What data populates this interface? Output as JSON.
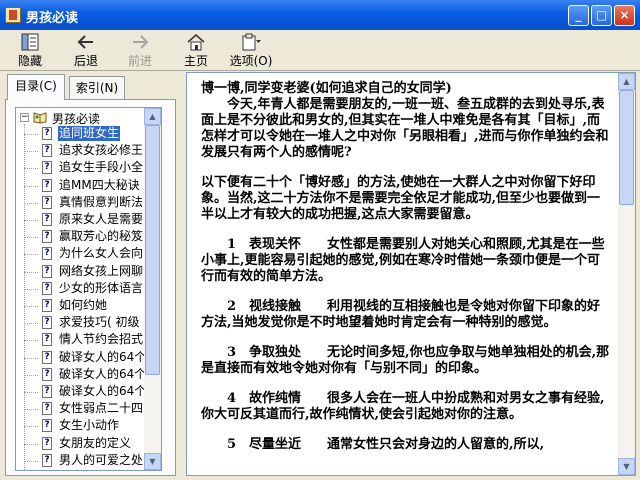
{
  "window": {
    "title": "男孩必读",
    "minimize_glyph": "_",
    "maximize_glyph": "□",
    "close_glyph": "×"
  },
  "toolbar": {
    "hide_label": "隐藏",
    "back_label": "后退",
    "forward_label": "前进",
    "home_label": "主页",
    "options_label": "选项(O)"
  },
  "tabs": {
    "contents_label": "目录(C)",
    "index_label": "索引(N)"
  },
  "tree": {
    "root_label": "男孩必读",
    "items": [
      "追同班女生",
      "追求女孩必修王",
      "追女生手段小全",
      "追MM四大秘诀",
      "真情假意判断法",
      "原来女人是需要",
      "赢取芳心的秘笈",
      "为什么女人会向",
      "网络女孩上网聊",
      "少女的形体语言",
      "如何约她",
      "求爱技巧( 初级",
      "情人节约会招式",
      "破译女人的64个",
      "破译女人的64个",
      "破译女人的64个",
      "女性弱点二十四",
      "女生小动作",
      "女朋友的定义",
      "男人的可爱之处"
    ]
  },
  "article": {
    "title": "博一博,同学变老婆(如何追求自己的女同学)",
    "paragraphs": [
      "　　今天,年青人都是需要朋友的,一班一班、叁五成群的去到处寻乐,表面上是不分彼此和男女的,但其实在一堆人中难免是各有其「目标」,而怎样才可以令她在一堆人之中对你「另眼相看」,进而与你作单独约会和发展只有两个人的感情呢?",
      "以下便有二十个「博好感」的方法,使她在一大群人之中对你留下好印象。当然,这二十方法你不是需要完全依足才能成功,但至少也要做到一半以上才有较大的成功把握,这点大家需要留意。",
      "　　1　表现关怀　　女性都是需要别人对她关心和照顾,尤其是在一些小事上,更能容易引起她的感觉,例如在寒冷时借她一条颈巾便是一个可行而有效的简单方法。",
      "　　2　视线接触　　利用视线的互相接触也是令她对你留下印象的好方法,当她发觉你是不时地望着她时肯定会有一种特别的感觉。",
      "　　3　争取独处　　无论时间多短,你也应争取与她单独相处的机会,那是直接而有效地令她对你有「与别不同」的印象。",
      "　　4　故作纯情　　很多人会在一班人中扮成熟和对男女之事有经验,你大可反其道而行,故作纯情状,使会引起她对你的注意。",
      "　　5　尽量坐近　　通常女性只会对身边的人留意的,所以,"
    ]
  }
}
